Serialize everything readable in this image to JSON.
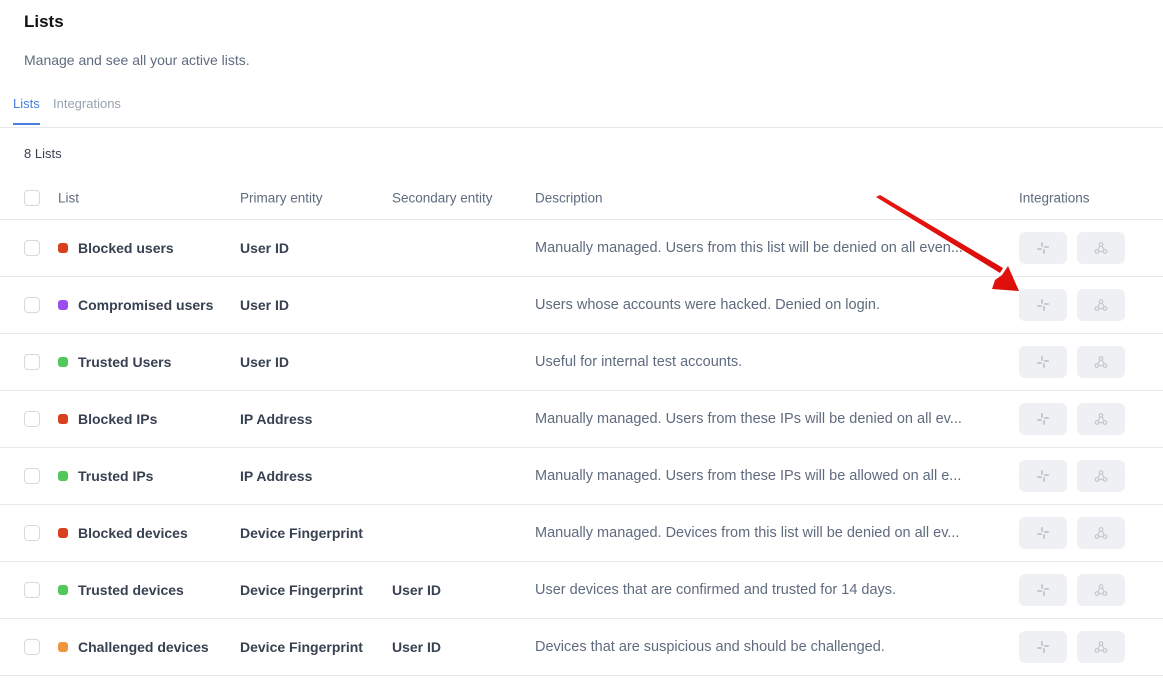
{
  "header": {
    "title": "Lists",
    "subtitle": "Manage and see all your active lists."
  },
  "tabs": [
    {
      "label": "Lists",
      "active": true
    },
    {
      "label": "Integrations",
      "active": false
    }
  ],
  "count_label": "8 Lists",
  "table": {
    "columns": {
      "list": "List",
      "primary": "Primary entity",
      "secondary": "Secondary entity",
      "description": "Description",
      "integrations": "Integrations"
    },
    "rows": [
      {
        "name": "Blocked users",
        "color": "#d9411e",
        "primary": "User ID",
        "secondary": "",
        "description": "Manually managed. Users from this list will be denied on all even..."
      },
      {
        "name": "Compromised users",
        "color": "#9b4ef0",
        "primary": "User ID",
        "secondary": "",
        "description": "Users whose accounts were hacked. Denied on login."
      },
      {
        "name": "Trusted Users",
        "color": "#52c75a",
        "primary": "User ID",
        "secondary": "",
        "description": "Useful for internal test accounts."
      },
      {
        "name": "Blocked IPs",
        "color": "#d9411e",
        "primary": "IP Address",
        "secondary": "",
        "description": "Manually managed. Users from these IPs will be denied on all ev..."
      },
      {
        "name": "Trusted IPs",
        "color": "#52c75a",
        "primary": "IP Address",
        "secondary": "",
        "description": "Manually managed. Users from these IPs will be allowed on all e..."
      },
      {
        "name": "Blocked devices",
        "color": "#d9411e",
        "primary": "Device Fingerprint",
        "secondary": "",
        "description": "Manually managed. Devices from this list will be denied on all ev..."
      },
      {
        "name": "Trusted devices",
        "color": "#52c75a",
        "primary": "Device Fingerprint",
        "secondary": "User ID",
        "description": "User devices that are confirmed and trusted for 14 days."
      },
      {
        "name": "Challenged devices",
        "color": "#f2963d",
        "primary": "Device Fingerprint",
        "secondary": "User ID",
        "description": "Devices that are suspicious and should be challenged."
      }
    ],
    "integration_icons": [
      "slack-icon",
      "webhook-icon"
    ]
  },
  "annotation": {
    "type": "arrow",
    "color": "#e8140f",
    "points_to": "Compromised users integration buttons"
  }
}
